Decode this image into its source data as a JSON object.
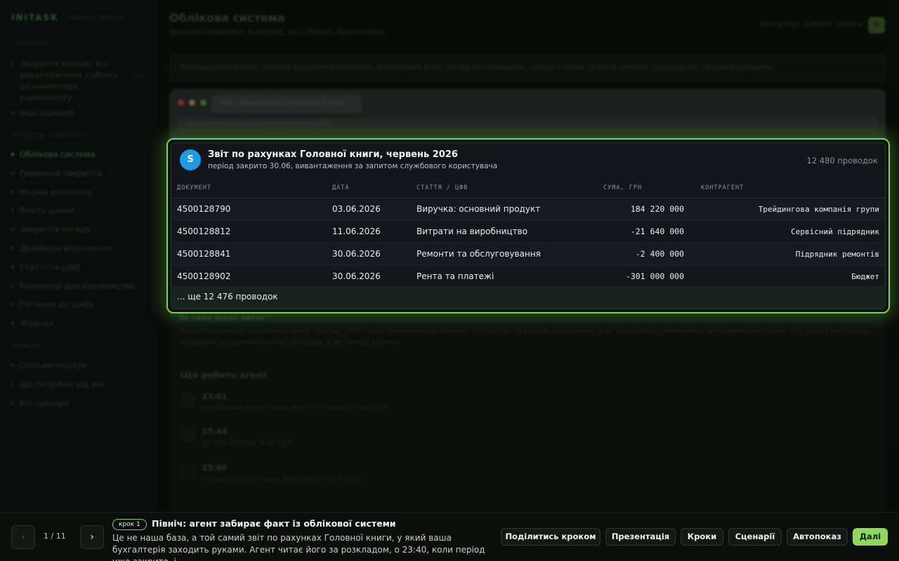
{
  "app": {
    "brand": "INITASK",
    "brand_sub": "кабінет агента"
  },
  "sidebar": {
    "sections": [
      {
        "heading": "Сценарій"
      },
      {
        "heading": "Розділи сценарію"
      },
      {
        "heading": "Нижче"
      }
    ],
    "scenario_items": [
      {
        "label": "Закриття місяця: від вивантаження з обліку до коментаря керівництву",
        "badge": "1/11"
      },
      {
        "label": "Інші сценарії"
      }
    ],
    "section_items": [
      {
        "label": "Облікова система",
        "active": true
      },
      {
        "label": "Скринька закриття"
      },
      {
        "label": "Форма допомоги"
      },
      {
        "label": "Якість даних"
      },
      {
        "label": "Закриття місяця"
      },
      {
        "label": "Драйвери відхилення"
      },
      {
        "label": "Статті та ЦФВ"
      },
      {
        "label": "Коментар для керівництва"
      },
      {
        "label": "Питання до цифр"
      },
      {
        "label": "Журнал"
      }
    ],
    "bottom_items": [
      {
        "label": "Скільки коштує"
      },
      {
        "label": "Що потрібно від вас"
      },
      {
        "label": "Усі сценарії"
      }
    ]
  },
  "header": {
    "title": "Облікова система",
    "subtitle": "фактичні проводки за період, як їх бачить бухгалтерія",
    "right_text": "Бухгалтер, кабінет агента",
    "avatar": "Б"
  },
  "notice": "Впровадження кейс. Велика виробнича компанія, фінансовий блок. Назву не називаємо, цифри і назви об'єктів змінені, порядок дій і екрани справжні.",
  "browser": {
    "tab_title": "SAP · Фінансова бухгалтерія (FI/CO)",
    "url": "sap.company.local/gl/accounts/export/FBL3N"
  },
  "report": {
    "logo_letter": "S",
    "title": "Звіт по рахунках Головної книги, червень 2026",
    "subtitle": "період закрито 30.06, вивантаження за запитом службового користувача",
    "count": "12 480 проводок",
    "columns": [
      "ДОКУМЕНТ",
      "ДАТА",
      "СТАТТЯ / ЦФВ",
      "СУМА, ГРН",
      "КОНТРАГЕНТ"
    ],
    "rows": [
      {
        "doc": "4500128790",
        "date": "03.06.2026",
        "item": "Виручка: основний продукт",
        "amount": "184 220 000",
        "counterparty": "Трейдингова компанія групи"
      },
      {
        "doc": "4500128812",
        "date": "11.06.2026",
        "item": "Витрати на виробництво",
        "amount": "-21 640 000",
        "counterparty": "Сервісний підрядник"
      },
      {
        "doc": "4500128841",
        "date": "30.06.2026",
        "item": "Ремонти та обслуговування",
        "amount": "-2 400 000",
        "counterparty": "Підрядник ремонтів"
      },
      {
        "doc": "4500128902",
        "date": "30.06.2026",
        "item": "Рента та платежі",
        "amount": "-301 000 000",
        "counterparty": "Бюджет"
      }
    ],
    "more": "... ще 12 476 проводок"
  },
  "criteria": {
    "title": "Як саме агент читає",
    "text": "Агент бере номер документа, дату, статтю, ЦФВ, суму і контрагента. Маппінг статей іде за вашим довідником, а не за нашими уявленнями про правильний план. Усе, що не вписалось, потрапляє в окремий список на розбір, а не зникає в сумах."
  },
  "agent": {
    "title": "Що робить агент",
    "steps": [
      {
        "time": "23:41",
        "desc": "службовий користувач, доступ тільки на читання"
      },
      {
        "time": "23:44",
        "desc": "12 480 записів, 4 хв 12 с"
      },
      {
        "time": "23:46",
        "desc": "за довідником групи, версія від 31.03.2025"
      }
    ]
  },
  "bottom": {
    "prev": "‹",
    "next": "›",
    "pager": "1 / 11",
    "step_badge": "крок 1",
    "step_title": "Північ: агент забирає факт із облікової системи",
    "step_desc": "Це не наша база, а той самий звіт по рахунках Головної книги, у який ваша бухгалтерія заходить руками. Агент читає його за розкладом, о 23:40, коли період уже закрито, і...",
    "buttons": [
      "Поділитись кроком",
      "Презентація",
      "Кроки",
      "Сценарії",
      "Автопоказ",
      "Далі"
    ]
  },
  "colors": {
    "accent": "#7bd44a",
    "logo": "#1e9be7",
    "primary_button": "#8fd85a"
  }
}
